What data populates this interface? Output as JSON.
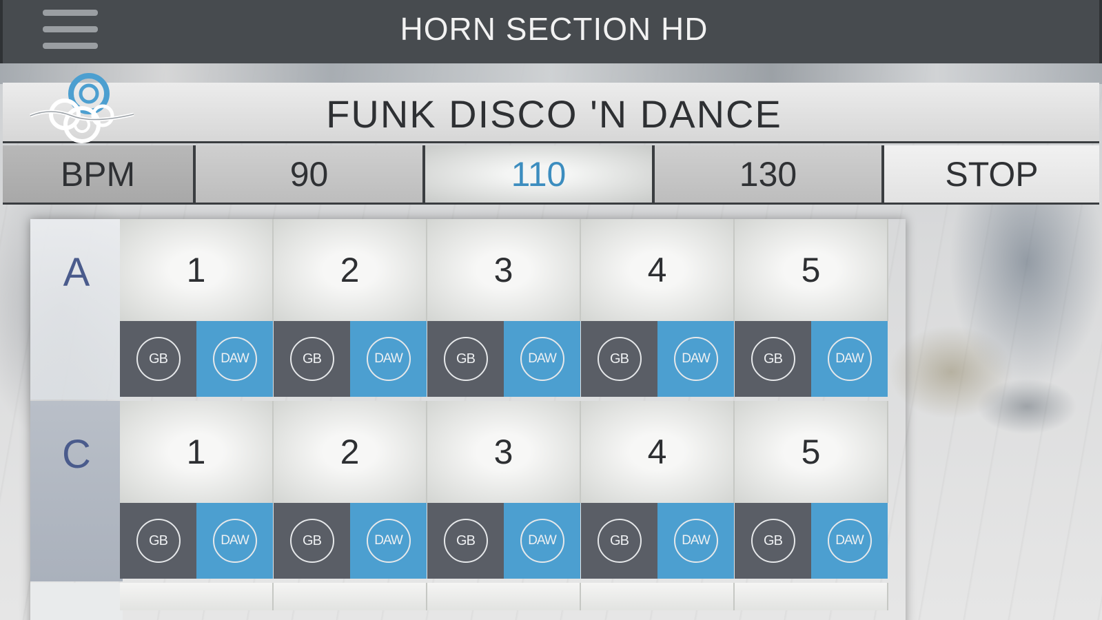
{
  "app_bar": {
    "title": "HORN SECTION HD",
    "menu_icon": "hamburger-menu-icon"
  },
  "banner": {
    "title": "FUNK  DISCO  'N  DANCE",
    "logo_icon": "swirl-logo-icon"
  },
  "tempo": {
    "label": "BPM",
    "options": [
      "90",
      "110",
      "130"
    ],
    "selected": "110",
    "stop_label": "STOP"
  },
  "grid": {
    "rows": [
      {
        "key": "A",
        "pads": [
          "1",
          "2",
          "3",
          "4",
          "5"
        ]
      },
      {
        "key": "C",
        "pads": [
          "1",
          "2",
          "3",
          "4",
          "5"
        ]
      }
    ],
    "export_gb_label": "GB",
    "export_daw_label": "DAW"
  },
  "colors": {
    "header_bg": "#474b4f",
    "active_tempo": "#3c8dbf",
    "gb_bg": "#5a5e66",
    "daw_bg": "#4c9fd0",
    "key_label": "#4a5b8c"
  }
}
